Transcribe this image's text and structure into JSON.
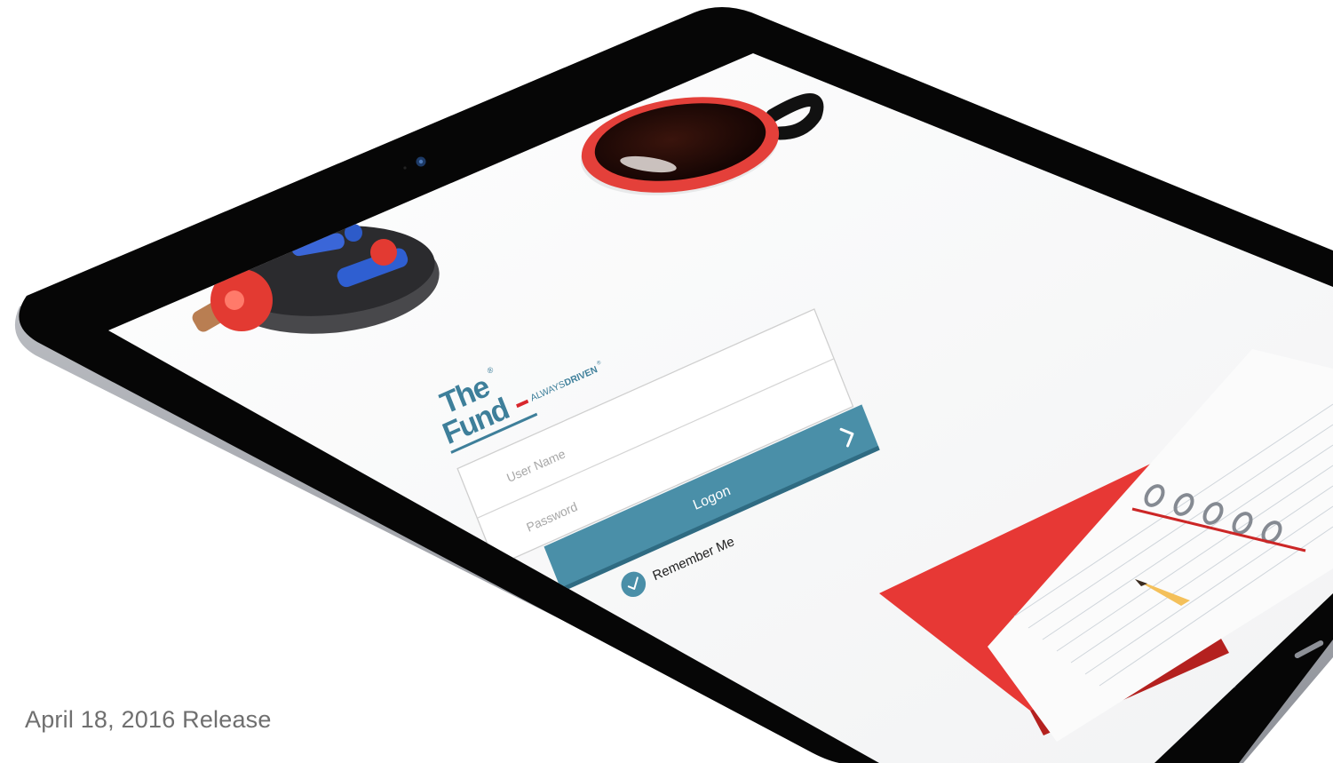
{
  "release": {
    "text": "April 18, 2016 Release"
  },
  "app": {
    "logo": {
      "line1": "The",
      "line2": "Fund",
      "registered": "®",
      "tagline_plain": "ALWAYS",
      "tagline_bold": "DRIVEN",
      "tagline_mark": "®"
    },
    "login": {
      "username_placeholder": "User Name",
      "password_placeholder": "Password",
      "logon_label": "Logon",
      "logon_arrow_icon": "chevron-right-icon",
      "remember_label": "Remember Me",
      "remember_checked": true
    }
  },
  "colors": {
    "accent": "#4a8fa8",
    "brand_teal": "#3e7f9a",
    "brand_red": "#d8262c",
    "device_frame": "#060606",
    "device_edge": "#b9bcc2",
    "release_text": "#6f6f6f"
  }
}
